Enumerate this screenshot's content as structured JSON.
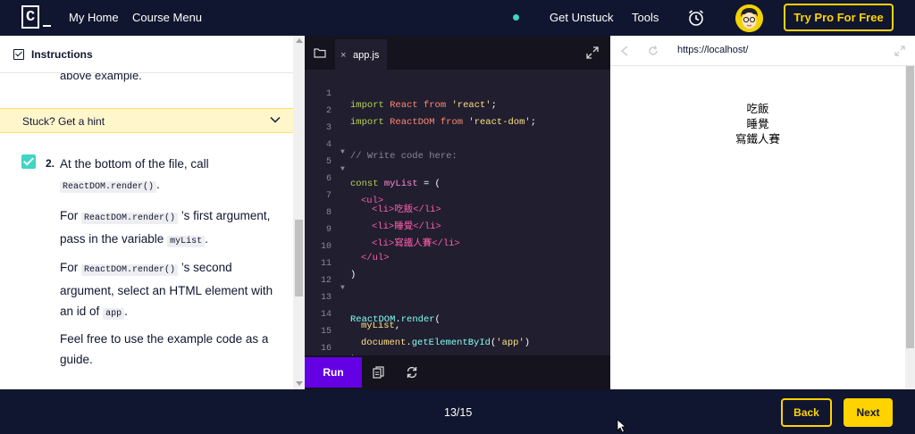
{
  "nav": {
    "logo_letter": "C",
    "my_home": "My Home",
    "course_menu": "Course Menu",
    "get_unstuck": "Get Unstuck",
    "tools": "Tools",
    "try_pro": "Try Pro For Free"
  },
  "instructions": {
    "header": "Instructions",
    "prev_text": "above example.",
    "hint": "Stuck? Get a hint",
    "task_number": "2.",
    "p1_a": "At the bottom of the file, call",
    "p1_code": "ReactDOM.render()",
    "p1_b": ".",
    "p2_a": "For",
    "p2_code": "ReactDOM.render()",
    "p2_b": "’s first argument, pass in the variable",
    "p2_code2": "myList",
    "p2_c": ".",
    "p3_a": "For",
    "p3_code": "ReactDOM.render()",
    "p3_b": "’s second argument, select an HTML element with an id of",
    "p3_code2": "app",
    "p3_c": ".",
    "p4": "Feel free to use the example code as a guide."
  },
  "editor": {
    "tab_close": "×",
    "tab_name": "app.js",
    "run": "Run",
    "lines": [
      {
        "n": "1",
        "fold": ""
      },
      {
        "n": "2",
        "fold": ""
      },
      {
        "n": "3",
        "fold": ""
      },
      {
        "n": "4",
        "fold": ""
      },
      {
        "n": "5",
        "fold": "▼"
      },
      {
        "n": "6",
        "fold": "▼"
      },
      {
        "n": "7",
        "fold": ""
      },
      {
        "n": "8",
        "fold": ""
      },
      {
        "n": "9",
        "fold": ""
      },
      {
        "n": "10",
        "fold": ""
      },
      {
        "n": "11",
        "fold": ""
      },
      {
        "n": "12",
        "fold": ""
      },
      {
        "n": "13",
        "fold": "▼"
      },
      {
        "n": "14",
        "fold": ""
      },
      {
        "n": "15",
        "fold": ""
      },
      {
        "n": "16",
        "fold": ""
      }
    ],
    "code": {
      "l1_kw": "import",
      "l1_id": "React",
      "l1_from": "from",
      "l1_str": "'react'",
      "l1_end": ";",
      "l2_kw": "import",
      "l2_id": "ReactDOM",
      "l2_from": "from",
      "l2_str": "'react-dom'",
      "l2_end": ";",
      "l4": "// Write code here:",
      "l5_kw": "const",
      "l5_var": "myList",
      "l5_rest": "= (",
      "l6": "<ul>",
      "l7_open": "<li>",
      "l7_text": "吃飯",
      "l7_close": "</li>",
      "l8_open": "<li>",
      "l8_text": "睡覺",
      "l8_close": "</li>",
      "l9_open": "<li>",
      "l9_text": "寫鐵人賽",
      "l9_close": "</li>",
      "l10": "</ul>",
      "l11": ")",
      "l13_obj": "ReactDOM",
      "l13_dot": ".",
      "l13_fn": "render",
      "l13_paren": "(",
      "l14_var": "myList",
      "l14_comma": ",",
      "l15_obj": "document",
      "l15_dot": ".",
      "l15_fn": "getElementById",
      "l15_open": "(",
      "l15_str": "'app'",
      "l15_close": ")",
      "l16": ");"
    }
  },
  "browser": {
    "url": "https://localhost/",
    "output": [
      "吃飯",
      "睡覺",
      "寫鐵人賽"
    ]
  },
  "footer": {
    "progress": "13/15",
    "back": "Back",
    "next": "Next"
  },
  "colors": {
    "navy": "#10162f",
    "yellow": "#ffd300",
    "teal": "#3fd6c3",
    "purple": "#6400e4",
    "hint_bg": "#fff6cc"
  }
}
